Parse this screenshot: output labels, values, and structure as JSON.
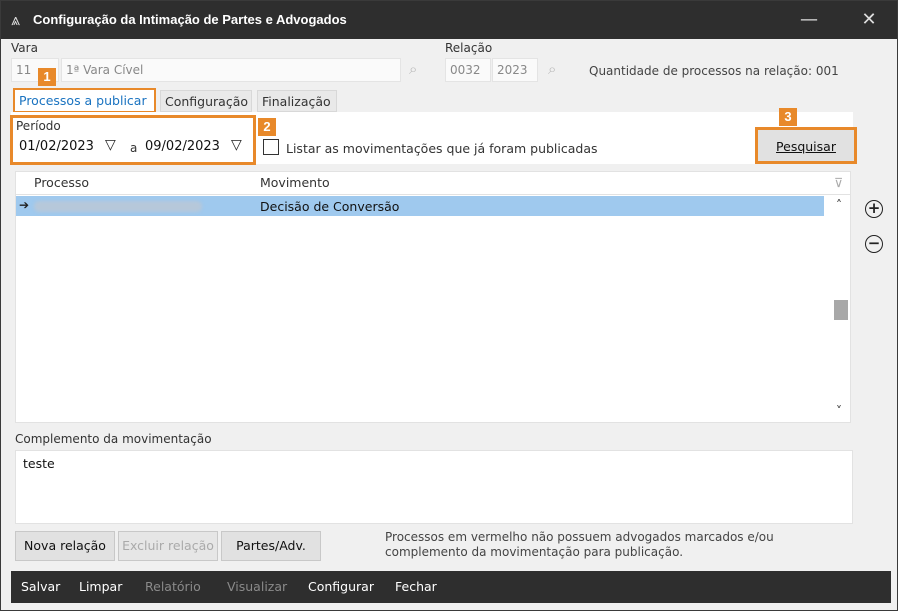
{
  "window": {
    "title": "Configuração da Intimação de Partes e Advogados",
    "minimize_symbol": "—",
    "close_symbol": "✕"
  },
  "vara": {
    "label": "Vara",
    "code": "11",
    "name": "1ª Vara Cível"
  },
  "relacao": {
    "label": "Relação",
    "number": "0032",
    "year": "2023",
    "quantity_text": "Quantidade de processos na relação: 001"
  },
  "tabs": [
    {
      "label": "Processos a publicar",
      "active": true
    },
    {
      "label": "Configuração",
      "active": false
    },
    {
      "label": "Finalização",
      "active": false
    }
  ],
  "badges": [
    "1",
    "2",
    "3"
  ],
  "periodo": {
    "label": "Período",
    "start": "01/02/2023",
    "separator": "a",
    "end": "09/02/2023"
  },
  "listar_checkbox": {
    "label": "Listar as movimentações que já foram publicadas",
    "checked": false
  },
  "pesquisar_button": "Pesquisar",
  "grid": {
    "columns": [
      "Processo",
      "Movimento"
    ],
    "rows": [
      {
        "processo": "",
        "movimento": "Decisão de Conversão",
        "selected": true
      }
    ]
  },
  "complemento": {
    "label": "Complemento da movimentação",
    "value": "teste"
  },
  "action_buttons": {
    "nova_relacao": "Nova relação",
    "excluir_relacao": "Excluir relação",
    "partes_adv": "Partes/Adv."
  },
  "info_text": "Processos em vermelho não possuem advogados marcados e/ou complemento da movimentação para publicação.",
  "bottom_menu": [
    {
      "label": "Salvar",
      "enabled": true
    },
    {
      "label": "Limpar",
      "enabled": true
    },
    {
      "label": "Relatório",
      "enabled": false
    },
    {
      "label": "Visualizar",
      "enabled": false
    },
    {
      "label": "Configurar",
      "enabled": true
    },
    {
      "label": "Fechar",
      "enabled": true
    }
  ],
  "colors": {
    "accent": "#e8892a",
    "selected_row": "#9fc9ee",
    "title_bar": "#2e2e2e",
    "active_tab_text": "#1a73c0"
  },
  "icons": [
    "app-icon",
    "search-icon",
    "chevron-down-icon",
    "row-arrow-icon",
    "filter-icon",
    "scroll-up-icon",
    "scroll-down-icon",
    "add-circle-icon",
    "remove-circle-icon"
  ]
}
